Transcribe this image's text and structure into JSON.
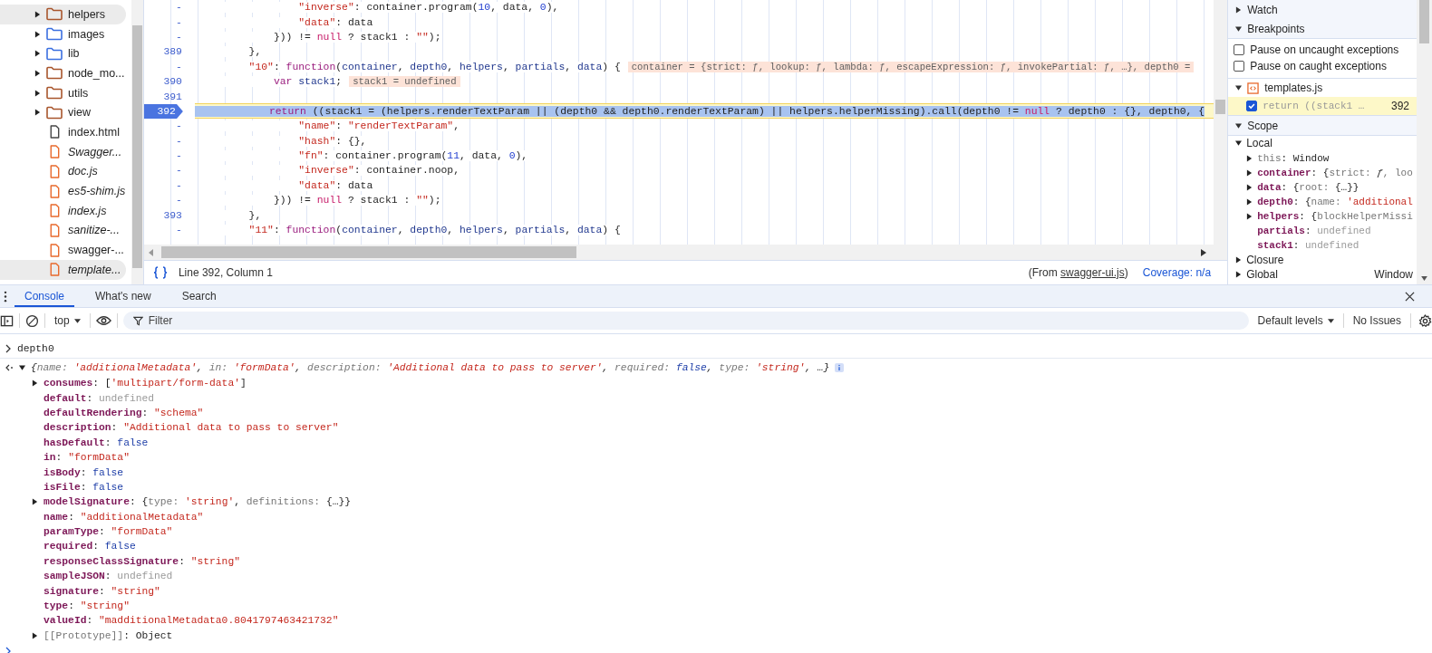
{
  "file_tree": {
    "items": [
      {
        "kind": "folder",
        "label": "helpers",
        "color": "#a8552c",
        "expanded": false,
        "selected": true,
        "italic": false
      },
      {
        "kind": "folder",
        "label": "images",
        "color": "#3b6fe0",
        "expanded": false,
        "selected": false,
        "italic": false
      },
      {
        "kind": "folder",
        "label": "lib",
        "color": "#3b6fe0",
        "expanded": false,
        "selected": false,
        "italic": false
      },
      {
        "kind": "folder",
        "label": "node_mo...",
        "color": "#a8552c",
        "expanded": false,
        "selected": false,
        "italic": false
      },
      {
        "kind": "folder",
        "label": "utils",
        "color": "#a8552c",
        "expanded": false,
        "selected": false,
        "italic": false
      },
      {
        "kind": "folder",
        "label": "view",
        "color": "#a8552c",
        "expanded": false,
        "selected": false,
        "italic": false
      },
      {
        "kind": "file",
        "label": "index.html",
        "color": "#474747",
        "selected": false,
        "italic": false
      },
      {
        "kind": "file",
        "label": "Swagger...",
        "color": "#e8692c",
        "selected": false,
        "italic": true
      },
      {
        "kind": "file",
        "label": "doc.js",
        "color": "#e8692c",
        "selected": false,
        "italic": true
      },
      {
        "kind": "file",
        "label": "es5-shim.js",
        "color": "#e8692c",
        "selected": false,
        "italic": true
      },
      {
        "kind": "file",
        "label": "index.js",
        "color": "#e8692c",
        "selected": false,
        "italic": true
      },
      {
        "kind": "file",
        "label": "sanitize-...",
        "color": "#e8692c",
        "selected": false,
        "italic": true
      },
      {
        "kind": "file",
        "label": "swagger-...",
        "color": "#e8692c",
        "selected": false,
        "italic": false
      },
      {
        "kind": "file",
        "label": "template...",
        "color": "#e8692c",
        "selected": true,
        "italic": true
      }
    ]
  },
  "editor": {
    "lines": [
      {
        "gutter": "-",
        "current": false,
        "breakpoint": false,
        "tokens": [
          {
            "t": "                \"inverse\"",
            "kind": "string"
          },
          {
            "t": ": container.program(",
            "kind": "plain"
          },
          {
            "t": "10",
            "kind": "number"
          },
          {
            "t": ", data, ",
            "kind": "plain"
          },
          {
            "t": "0",
            "kind": "number"
          },
          {
            "t": "),",
            "kind": "plain"
          }
        ]
      },
      {
        "gutter": "-",
        "current": false,
        "breakpoint": false,
        "tokens": [
          {
            "t": "                \"data\"",
            "kind": "string"
          },
          {
            "t": ": data",
            "kind": "plain"
          }
        ]
      },
      {
        "gutter": "-",
        "current": false,
        "breakpoint": false,
        "tokens": [
          {
            "t": "            })) != ",
            "kind": "plain"
          },
          {
            "t": "null",
            "kind": "literal"
          },
          {
            "t": " ? stack1 : ",
            "kind": "plain"
          },
          {
            "t": "\"\"",
            "kind": "string"
          },
          {
            "t": ");",
            "kind": "plain"
          }
        ]
      },
      {
        "gutter": "389",
        "current": false,
        "breakpoint": false,
        "tokens": [
          {
            "t": "        },",
            "kind": "plain"
          }
        ]
      },
      {
        "gutter": "-",
        "current": false,
        "breakpoint": false,
        "tokens": [
          {
            "t": "        \"10\"",
            "kind": "string"
          },
          {
            "t": ": ",
            "kind": "plain"
          },
          {
            "t": "function",
            "kind": "keyword"
          },
          {
            "t": "(",
            "kind": "plain"
          },
          {
            "t": "container",
            "kind": "param"
          },
          {
            "t": ", ",
            "kind": "plain"
          },
          {
            "t": "depth0",
            "kind": "param"
          },
          {
            "t": ", ",
            "kind": "plain"
          },
          {
            "t": "helpers",
            "kind": "param"
          },
          {
            "t": ", ",
            "kind": "plain"
          },
          {
            "t": "partials",
            "kind": "param"
          },
          {
            "t": ", ",
            "kind": "plain"
          },
          {
            "t": "data",
            "kind": "param"
          },
          {
            "t": ") {",
            "kind": "plain"
          }
        ],
        "inline_value": "container = {strict: ƒ, lookup: ƒ, lambda: ƒ, escapeExpression: ƒ, invokePartial: ƒ, …}, depth0 ="
      },
      {
        "gutter": "390",
        "current": false,
        "breakpoint": false,
        "tokens": [
          {
            "t": "            var",
            "kind": "keyword"
          },
          {
            "t": " stack1",
            "kind": "param"
          },
          {
            "t": ";",
            "kind": "plain"
          }
        ],
        "inline_value": "stack1 = undefined"
      },
      {
        "gutter": "391",
        "current": false,
        "breakpoint": false
      },
      {
        "gutter": "392",
        "current": true,
        "breakpoint": true,
        "tokens": [
          {
            "t": "            return",
            "kind": "keyword"
          },
          {
            "t": " ((stack1 = (helpers.renderTextParam || (depth0 && depth0.renderTextParam) || helpers.helperMissing).call(depth0 != ",
            "kind": "plain"
          },
          {
            "t": "null",
            "kind": "literal"
          },
          {
            "t": " ? depth0 : {}, depth0, {",
            "kind": "plain"
          }
        ]
      },
      {
        "gutter": "-",
        "current": false,
        "breakpoint": false,
        "tokens": [
          {
            "t": "                \"name\"",
            "kind": "string"
          },
          {
            "t": ": ",
            "kind": "plain"
          },
          {
            "t": "\"renderTextParam\"",
            "kind": "string"
          },
          {
            "t": ",",
            "kind": "plain"
          }
        ]
      },
      {
        "gutter": "-",
        "current": false,
        "breakpoint": false,
        "tokens": [
          {
            "t": "                \"hash\"",
            "kind": "string"
          },
          {
            "t": ": {},",
            "kind": "plain"
          }
        ]
      },
      {
        "gutter": "-",
        "current": false,
        "breakpoint": false,
        "tokens": [
          {
            "t": "                \"fn\"",
            "kind": "string"
          },
          {
            "t": ": container.program(",
            "kind": "plain"
          },
          {
            "t": "11",
            "kind": "number"
          },
          {
            "t": ", data, ",
            "kind": "plain"
          },
          {
            "t": "0",
            "kind": "number"
          },
          {
            "t": "),",
            "kind": "plain"
          }
        ]
      },
      {
        "gutter": "-",
        "current": false,
        "breakpoint": false,
        "tokens": [
          {
            "t": "                \"inverse\"",
            "kind": "string"
          },
          {
            "t": ": container.noop,",
            "kind": "plain"
          }
        ]
      },
      {
        "gutter": "-",
        "current": false,
        "breakpoint": false,
        "tokens": [
          {
            "t": "                \"data\"",
            "kind": "string"
          },
          {
            "t": ": data",
            "kind": "plain"
          }
        ]
      },
      {
        "gutter": "-",
        "current": false,
        "breakpoint": false,
        "tokens": [
          {
            "t": "            })) != ",
            "kind": "plain"
          },
          {
            "t": "null",
            "kind": "literal"
          },
          {
            "t": " ? stack1 : ",
            "kind": "plain"
          },
          {
            "t": "\"\"",
            "kind": "string"
          },
          {
            "t": ");",
            "kind": "plain"
          }
        ]
      },
      {
        "gutter": "393",
        "current": false,
        "breakpoint": false,
        "tokens": [
          {
            "t": "        },",
            "kind": "plain"
          }
        ]
      },
      {
        "gutter": "-",
        "current": false,
        "breakpoint": false,
        "tokens": [
          {
            "t": "        \"11\"",
            "kind": "string"
          },
          {
            "t": ": ",
            "kind": "plain"
          },
          {
            "t": "function",
            "kind": "keyword"
          },
          {
            "t": "(",
            "kind": "plain"
          },
          {
            "t": "container",
            "kind": "param"
          },
          {
            "t": ", ",
            "kind": "plain"
          },
          {
            "t": "depth0",
            "kind": "param"
          },
          {
            "t": ", ",
            "kind": "plain"
          },
          {
            "t": "helpers",
            "kind": "param"
          },
          {
            "t": ", ",
            "kind": "plain"
          },
          {
            "t": "partials",
            "kind": "param"
          },
          {
            "t": ", ",
            "kind": "plain"
          },
          {
            "t": "data",
            "kind": "param"
          },
          {
            "t": ") {",
            "kind": "plain"
          }
        ]
      }
    ]
  },
  "status_bar": {
    "position": "Line 392, Column 1",
    "source_prefix": "(From ",
    "source_link": "swagger-ui.js",
    "source_suffix": ")",
    "coverage": "Coverage: n/a"
  },
  "debugger_sidebar": {
    "watch": {
      "label": "Watch",
      "expanded": false
    },
    "breakpoints": {
      "label": "Breakpoints",
      "expanded": true,
      "options": [
        {
          "label": "Pause on uncaught exceptions",
          "checked": false
        },
        {
          "label": "Pause on caught exceptions",
          "checked": false
        }
      ],
      "files": [
        {
          "name": "templates.js",
          "expanded": true,
          "entries": [
            {
              "code": "return ((stack1 …",
              "line": "392",
              "checked": true,
              "current": true
            }
          ]
        }
      ]
    },
    "scope": {
      "label": "Scope",
      "expanded": true,
      "groups": [
        {
          "label": "Local",
          "expanded": true,
          "vars": [
            {
              "expandable": true,
              "tokens": [
                {
                  "t": "this",
                  "kind": "dimkey"
                },
                {
                  "t": ": ",
                  "kind": "plain"
                },
                {
                  "t": "Window",
                  "kind": "plain"
                }
              ]
            },
            {
              "expandable": true,
              "tokens": [
                {
                  "t": "container",
                  "kind": "key"
                },
                {
                  "t": ": ",
                  "kind": "plain"
                },
                {
                  "t": "{",
                  "kind": "plain"
                },
                {
                  "t": "strict: ",
                  "kind": "dim"
                },
                {
                  "t": "ƒ",
                  "kind": "func"
                },
                {
                  "t": ", loo",
                  "kind": "dim"
                }
              ]
            },
            {
              "expandable": true,
              "tokens": [
                {
                  "t": "data",
                  "kind": "key"
                },
                {
                  "t": ": ",
                  "kind": "plain"
                },
                {
                  "t": "{",
                  "kind": "plain"
                },
                {
                  "t": "root: ",
                  "kind": "dim"
                },
                {
                  "t": "{…}}",
                  "kind": "plain"
                }
              ]
            },
            {
              "expandable": true,
              "tokens": [
                {
                  "t": "depth0",
                  "kind": "key"
                },
                {
                  "t": ": ",
                  "kind": "plain"
                },
                {
                  "t": "{",
                  "kind": "plain"
                },
                {
                  "t": "name: ",
                  "kind": "dim"
                },
                {
                  "t": "'additional",
                  "kind": "string"
                }
              ]
            },
            {
              "expandable": true,
              "tokens": [
                {
                  "t": "helpers",
                  "kind": "key"
                },
                {
                  "t": ": ",
                  "kind": "plain"
                },
                {
                  "t": "{",
                  "kind": "plain"
                },
                {
                  "t": "blockHelperMissi",
                  "kind": "dim"
                }
              ]
            },
            {
              "expandable": false,
              "tokens": [
                {
                  "t": "partials",
                  "kind": "key"
                },
                {
                  "t": ": ",
                  "kind": "plain"
                },
                {
                  "t": "undefined",
                  "kind": "undef"
                }
              ]
            },
            {
              "expandable": false,
              "tokens": [
                {
                  "t": "stack1",
                  "kind": "key"
                },
                {
                  "t": ": ",
                  "kind": "plain"
                },
                {
                  "t": "undefined",
                  "kind": "undef"
                }
              ]
            }
          ]
        },
        {
          "label": "Closure",
          "expanded": false
        },
        {
          "label": "Global",
          "expanded": false,
          "value": "Window"
        }
      ]
    }
  },
  "console": {
    "tabs": [
      {
        "label": "Console",
        "selected": true
      },
      {
        "label": "What's new",
        "selected": false
      },
      {
        "label": "Search",
        "selected": false
      }
    ],
    "toolbar": {
      "context": "top",
      "filter_placeholder": "Filter",
      "levels": "Default levels",
      "issues": "No Issues"
    },
    "input": "depth0",
    "result": {
      "expanded": true,
      "summary": [
        {
          "t": "{",
          "kind": "plain"
        },
        {
          "t": "name: ",
          "kind": "dim"
        },
        {
          "t": "'additionalMetadata'",
          "kind": "string"
        },
        {
          "t": ", ",
          "kind": "plain"
        },
        {
          "t": "in: ",
          "kind": "dim"
        },
        {
          "t": "'formData'",
          "kind": "string"
        },
        {
          "t": ", ",
          "kind": "plain"
        },
        {
          "t": "description: ",
          "kind": "dim"
        },
        {
          "t": "'Additional data to pass to server'",
          "kind": "string"
        },
        {
          "t": ", ",
          "kind": "plain"
        },
        {
          "t": "required: ",
          "kind": "dim"
        },
        {
          "t": "false",
          "kind": "boolean"
        },
        {
          "t": ", ",
          "kind": "plain"
        },
        {
          "t": "type: ",
          "kind": "dim"
        },
        {
          "t": "'string'",
          "kind": "string"
        },
        {
          "t": ", …}",
          "kind": "plain"
        }
      ],
      "properties": [
        {
          "expandable": true,
          "tokens": [
            {
              "t": "consumes",
              "kind": "key"
            },
            {
              "t": ": [",
              "kind": "plain"
            },
            {
              "t": "'multipart/form-data'",
              "kind": "string"
            },
            {
              "t": "]",
              "kind": "plain"
            }
          ]
        },
        {
          "expandable": false,
          "tokens": [
            {
              "t": "default",
              "kind": "key"
            },
            {
              "t": ": ",
              "kind": "plain"
            },
            {
              "t": "undefined",
              "kind": "undef"
            }
          ]
        },
        {
          "expandable": false,
          "tokens": [
            {
              "t": "defaultRendering",
              "kind": "key"
            },
            {
              "t": ": ",
              "kind": "plain"
            },
            {
              "t": "\"schema\"",
              "kind": "string"
            }
          ]
        },
        {
          "expandable": false,
          "tokens": [
            {
              "t": "description",
              "kind": "key"
            },
            {
              "t": ": ",
              "kind": "plain"
            },
            {
              "t": "\"Additional data to pass to server\"",
              "kind": "string"
            }
          ]
        },
        {
          "expandable": false,
          "tokens": [
            {
              "t": "hasDefault",
              "kind": "key"
            },
            {
              "t": ": ",
              "kind": "plain"
            },
            {
              "t": "false",
              "kind": "boolean"
            }
          ]
        },
        {
          "expandable": false,
          "tokens": [
            {
              "t": "in",
              "kind": "key"
            },
            {
              "t": ": ",
              "kind": "plain"
            },
            {
              "t": "\"formData\"",
              "kind": "string"
            }
          ]
        },
        {
          "expandable": false,
          "tokens": [
            {
              "t": "isBody",
              "kind": "key"
            },
            {
              "t": ": ",
              "kind": "plain"
            },
            {
              "t": "false",
              "kind": "boolean"
            }
          ]
        },
        {
          "expandable": false,
          "tokens": [
            {
              "t": "isFile",
              "kind": "key"
            },
            {
              "t": ": ",
              "kind": "plain"
            },
            {
              "t": "false",
              "kind": "boolean"
            }
          ]
        },
        {
          "expandable": true,
          "tokens": [
            {
              "t": "modelSignature",
              "kind": "key"
            },
            {
              "t": ": {",
              "kind": "plain"
            },
            {
              "t": "type: ",
              "kind": "dim"
            },
            {
              "t": "'string'",
              "kind": "string"
            },
            {
              "t": ", ",
              "kind": "plain"
            },
            {
              "t": "definitions: ",
              "kind": "dim"
            },
            {
              "t": "{…}}",
              "kind": "plain"
            }
          ]
        },
        {
          "expandable": false,
          "tokens": [
            {
              "t": "name",
              "kind": "key"
            },
            {
              "t": ": ",
              "kind": "plain"
            },
            {
              "t": "\"additionalMetadata\"",
              "kind": "string"
            }
          ]
        },
        {
          "expandable": false,
          "tokens": [
            {
              "t": "paramType",
              "kind": "key"
            },
            {
              "t": ": ",
              "kind": "plain"
            },
            {
              "t": "\"formData\"",
              "kind": "string"
            }
          ]
        },
        {
          "expandable": false,
          "tokens": [
            {
              "t": "required",
              "kind": "key"
            },
            {
              "t": ": ",
              "kind": "plain"
            },
            {
              "t": "false",
              "kind": "boolean"
            }
          ]
        },
        {
          "expandable": false,
          "tokens": [
            {
              "t": "responseClassSignature",
              "kind": "key"
            },
            {
              "t": ": ",
              "kind": "plain"
            },
            {
              "t": "\"string\"",
              "kind": "string"
            }
          ]
        },
        {
          "expandable": false,
          "tokens": [
            {
              "t": "sampleJSON",
              "kind": "key"
            },
            {
              "t": ": ",
              "kind": "plain"
            },
            {
              "t": "undefined",
              "kind": "undef"
            }
          ]
        },
        {
          "expandable": false,
          "tokens": [
            {
              "t": "signature",
              "kind": "key"
            },
            {
              "t": ": ",
              "kind": "plain"
            },
            {
              "t": "\"string\"",
              "kind": "string"
            }
          ]
        },
        {
          "expandable": false,
          "tokens": [
            {
              "t": "type",
              "kind": "key"
            },
            {
              "t": ": ",
              "kind": "plain"
            },
            {
              "t": "\"string\"",
              "kind": "string"
            }
          ]
        },
        {
          "expandable": false,
          "tokens": [
            {
              "t": "valueId",
              "kind": "key"
            },
            {
              "t": ": ",
              "kind": "plain"
            },
            {
              "t": "\"madditionalMetadata0.8041797463421732\"",
              "kind": "string"
            }
          ]
        },
        {
          "expandable": true,
          "tokens": [
            {
              "t": "[[Prototype]]",
              "kind": "dimkey"
            },
            {
              "t": ": ",
              "kind": "plain"
            },
            {
              "t": "Object",
              "kind": "plain"
            }
          ]
        }
      ]
    }
  }
}
